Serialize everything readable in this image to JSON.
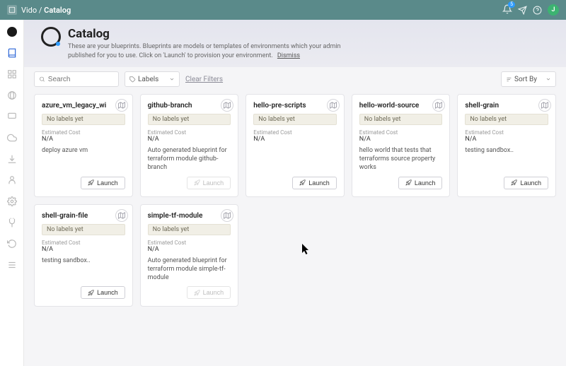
{
  "breadcrumb": {
    "space": "Vido",
    "page": "Catalog"
  },
  "banner": {
    "title": "Catalog",
    "subtitle": "These are your blueprints. Blueprints are models or templates of environments which your admin published for you to use. Click on 'Launch' to provision your environment.",
    "dismiss": "Dismiss"
  },
  "controls": {
    "searchPlaceholder": "Search",
    "labels": "Labels",
    "clear": "Clear Filters",
    "sortby": "Sort By"
  },
  "notifications": {
    "count": "5"
  },
  "avatar": {
    "initial": "J"
  },
  "cardDefaults": {
    "noLabels": "No labels yet",
    "estCost": "Estimated Cost",
    "na": "N/A",
    "launch": "Launch"
  },
  "cards": [
    {
      "title": "azure_vm_legacy_wi",
      "desc": "deploy azure vm",
      "disabled": false
    },
    {
      "title": "github-branch",
      "desc": "Auto generated blueprint for terraform module github-branch",
      "disabled": true
    },
    {
      "title": "hello-pre-scripts",
      "desc": "",
      "disabled": false
    },
    {
      "title": "hello-world-source",
      "desc": "hello world that tests that terraforms source property works",
      "disabled": false
    },
    {
      "title": "shell-grain",
      "desc": "testing sandbox..",
      "disabled": false
    },
    {
      "title": "shell-grain-file",
      "desc": "testing sandbox..",
      "disabled": false
    },
    {
      "title": "simple-tf-module",
      "desc": "Auto generated blueprint for terraform module simple-tf-module",
      "disabled": true
    }
  ]
}
